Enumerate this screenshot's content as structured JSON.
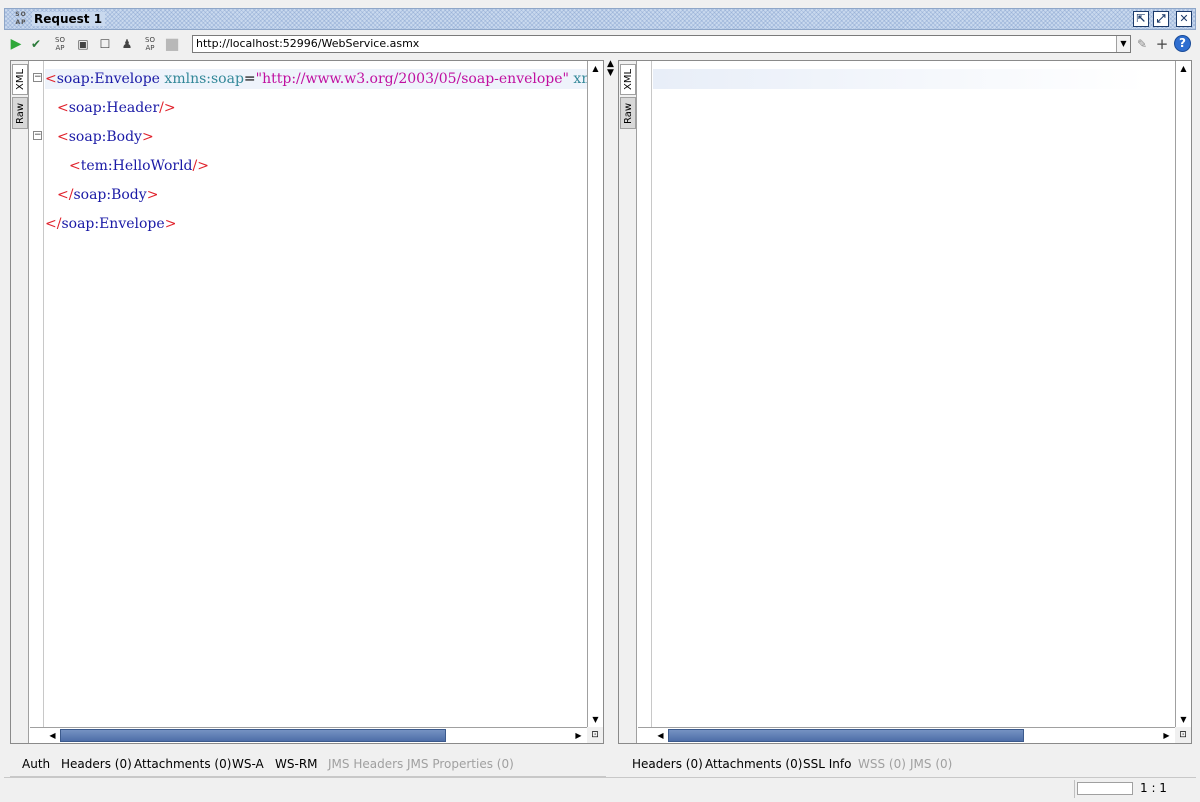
{
  "title": {
    "badge": "SO AP",
    "label": "Request 1"
  },
  "toolbar": {
    "url": "http://localhost:52996/WebService.asmx",
    "help_icon": "?"
  },
  "request": {
    "tabs": [
      "XML",
      "Raw"
    ],
    "xml_lines": [
      {
        "indent": 0,
        "open": "<",
        "tag": "soap:Envelope",
        "attr1": " xmlns:soap",
        "eq": "=",
        "val1": "\"http://www.w3.org/2003/05/soap-envelope\"",
        "attr2": " xmlns:tem",
        "eq2": "="
      },
      {
        "indent": 1,
        "open": "<",
        "tag": "soap:Header",
        "close": "/>"
      },
      {
        "indent": 1,
        "open": "<",
        "tag": "soap:Body",
        "close": ">"
      },
      {
        "indent": 2,
        "open": "<",
        "tag": "tem:HelloWorld",
        "close": "/>"
      },
      {
        "indent": 1,
        "open": "</",
        "tag": "soap:Body",
        "close": ">"
      },
      {
        "indent": 0,
        "open": "</",
        "tag": "soap:Envelope",
        "close": ">"
      }
    ],
    "bottom_tabs": [
      {
        "label": "Auth",
        "enabled": true
      },
      {
        "label": "Headers (0)",
        "enabled": true
      },
      {
        "label": "Attachments (0)",
        "enabled": true
      },
      {
        "label": "WS-A",
        "enabled": true
      },
      {
        "label": "WS-RM",
        "enabled": true
      },
      {
        "label": "JMS Headers",
        "enabled": false
      },
      {
        "label": "JMS Properties (0)",
        "enabled": false
      }
    ]
  },
  "response": {
    "tabs": [
      "XML",
      "Raw"
    ],
    "bottom_tabs": [
      {
        "label": "Headers (0)",
        "enabled": true
      },
      {
        "label": "Attachments (0)",
        "enabled": true
      },
      {
        "label": "SSL Info",
        "enabled": true
      },
      {
        "label": "WSS (0)",
        "enabled": false
      },
      {
        "label": "JMS (0)",
        "enabled": false
      }
    ]
  },
  "status": {
    "position": "1 : 1"
  },
  "colors": {
    "tag": "#1a1aa6",
    "bracket": "#e0202a",
    "attribute": "#338899",
    "value": "#c010a0",
    "scroll_thumb": "#5c7ab2"
  }
}
